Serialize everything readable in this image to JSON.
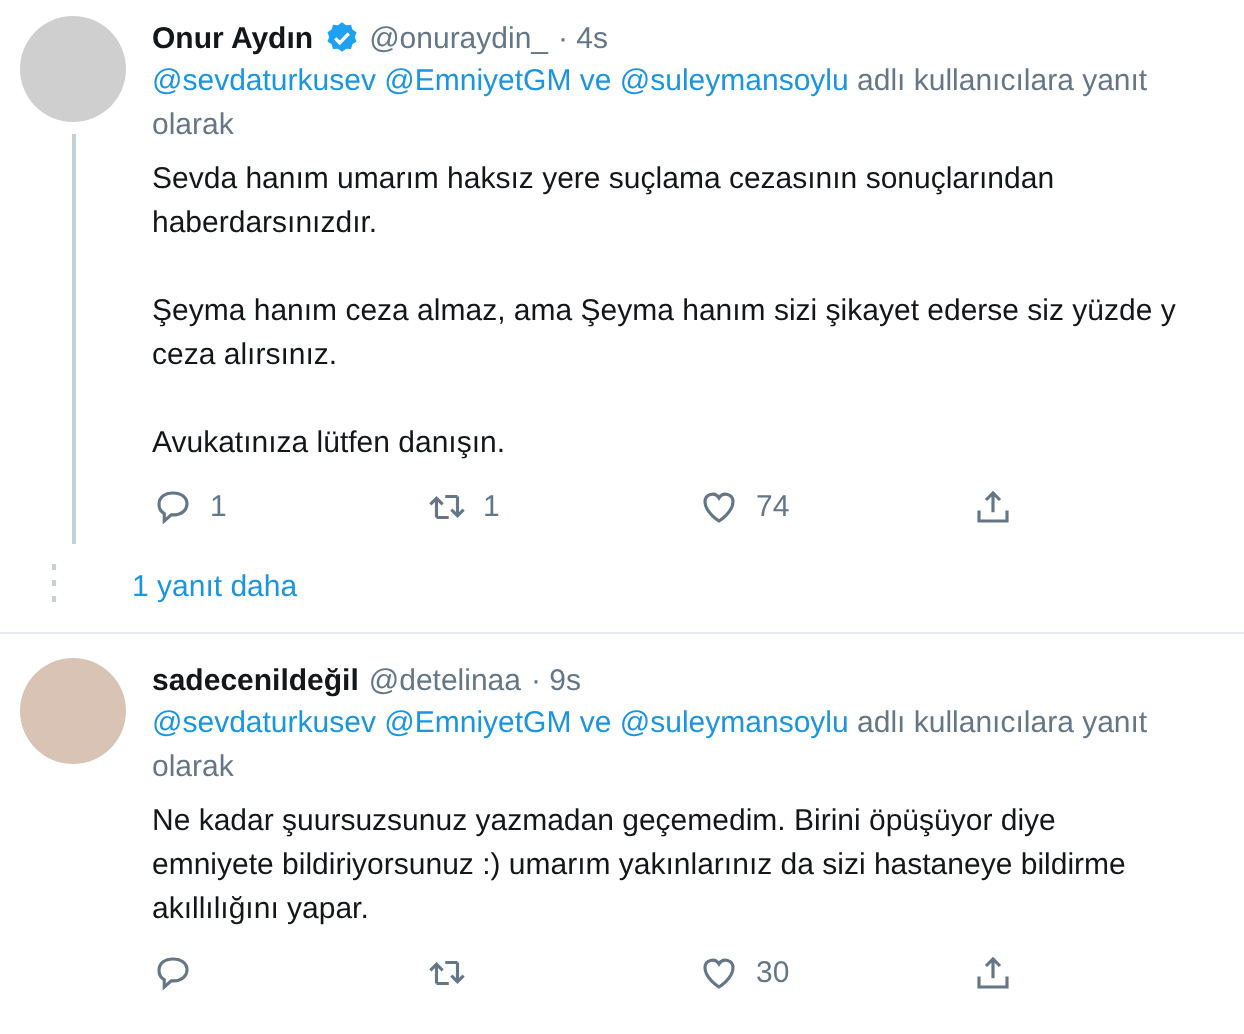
{
  "tweets": [
    {
      "name": "Onur Aydın",
      "verified": true,
      "handle": "@onuraydin_",
      "time": "· 4s",
      "thread_line": true,
      "reply_lines": [
        [
          {
            "kind": "mention",
            "text": "@sevdaturkusev"
          },
          {
            "kind": "mention",
            "text": "@EmniyetGM"
          },
          {
            "kind": "mention",
            "text": "ve"
          },
          {
            "kind": "mention",
            "text": "@suleymansoylu"
          },
          {
            "kind": "plain",
            "text": "adlı kullanıcılara yanıt"
          }
        ],
        [
          {
            "kind": "plain",
            "text": "olarak"
          }
        ]
      ],
      "paragraphs": [
        [
          "Sevda hanım umarım haksız yere suçlama cezasının sonuçlarından",
          "haberdarsınızdır."
        ],
        [
          "Şeyma hanım ceza almaz, ama Şeyma hanım sizi şikayet ederse siz yüzde y",
          "ceza alırsınız."
        ],
        [
          "Avukatınıza lütfen danışın."
        ]
      ],
      "actions": [
        {
          "kind": "reply",
          "count": "1"
        },
        {
          "kind": "retweet",
          "count": "1"
        },
        {
          "kind": "like",
          "count": "74"
        },
        {
          "kind": "share"
        }
      ],
      "more_replies": "1 yanıt daha"
    },
    {
      "name": "sadecenildeğil",
      "verified": false,
      "handle": "@detelinaa",
      "time": "· 9s",
      "thread_line": false,
      "reply_lines": [
        [
          {
            "kind": "mention",
            "text": "@sevdaturkusev"
          },
          {
            "kind": "mention",
            "text": "@EmniyetGM"
          },
          {
            "kind": "mention",
            "text": "ve"
          },
          {
            "kind": "mention",
            "text": "@suleymansoylu"
          },
          {
            "kind": "plain",
            "text": "adlı kullanıcılara yanıt"
          }
        ],
        [
          {
            "kind": "plain",
            "text": "olarak"
          }
        ]
      ],
      "paragraphs": [
        [
          "Ne kadar şuursuzsunuz yazmadan geçemedim. Birini öpüşüyor diye",
          "emniyete bildiriyorsunuz :) umarım yakınlarınız da sizi hastaneye bildirme",
          "akıllılığını yapar."
        ]
      ],
      "actions": [
        {
          "kind": "reply"
        },
        {
          "kind": "retweet"
        },
        {
          "kind": "like",
          "count": "30"
        },
        {
          "kind": "share"
        }
      ]
    }
  ]
}
